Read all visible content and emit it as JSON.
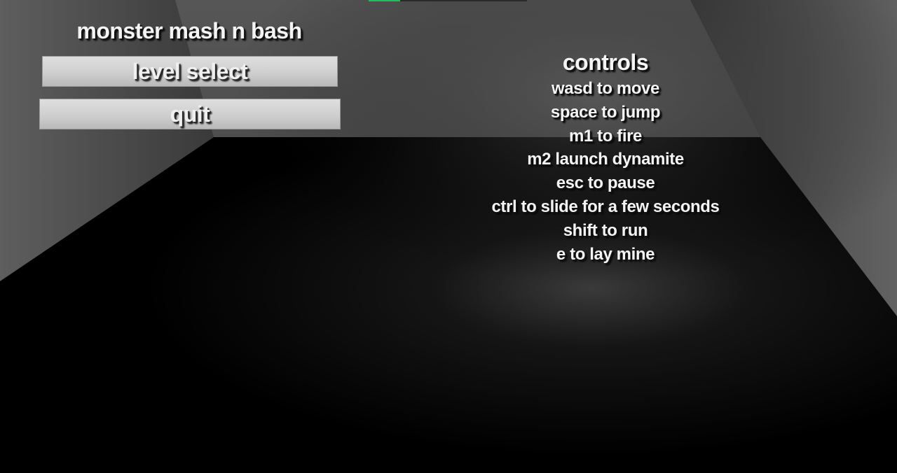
{
  "loading_bar": {
    "progress": 0.2,
    "fill_color": "#1fbf5a"
  },
  "main_menu": {
    "title": "monster mash n bash",
    "buttons": {
      "level_select": "level select",
      "quit": "quit"
    }
  },
  "controls": {
    "heading": "controls",
    "lines": [
      "wasd to move",
      "space to jump",
      "m1 to fire",
      "m2 launch dynamite",
      "esc to pause",
      "ctrl to slide for a few seconds",
      "shift to run",
      "e to lay mine"
    ]
  }
}
